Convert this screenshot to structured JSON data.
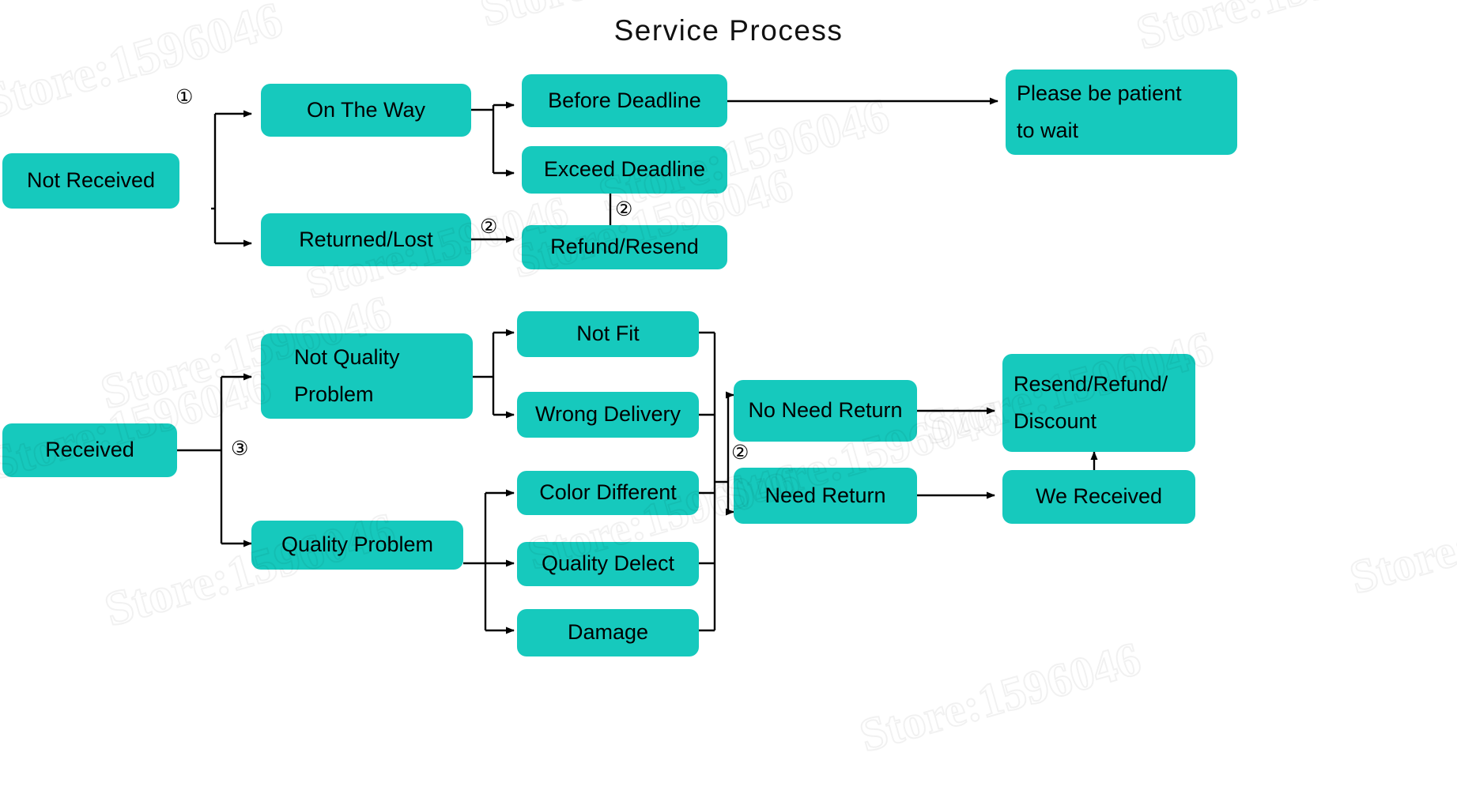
{
  "title": "Service Process",
  "colors": {
    "box_fill": "#16c9bd",
    "line": "#000000",
    "text": "#000000",
    "background": "#ffffff"
  },
  "watermark": {
    "text": "Store:1596046"
  },
  "nodes": {
    "not_received": {
      "label": "Not Received"
    },
    "on_the_way": {
      "label": "On The Way"
    },
    "returned_lost": {
      "label": "Returned/Lost"
    },
    "before_deadline": {
      "label": "Before Deadline"
    },
    "exceed_deadline": {
      "label": "Exceed Deadline"
    },
    "refund_resend": {
      "label": "Refund/Resend"
    },
    "please_wait_1": {
      "label": "Please be patient"
    },
    "please_wait_2": {
      "label": "to wait"
    },
    "received": {
      "label": "Received"
    },
    "not_quality_1": {
      "label": "Not Quality"
    },
    "not_quality_2": {
      "label": "Problem"
    },
    "quality_problem": {
      "label": "Quality Problem"
    },
    "not_fit": {
      "label": "Not Fit"
    },
    "wrong_delivery": {
      "label": "Wrong Delivery"
    },
    "color_different": {
      "label": "Color Different"
    },
    "quality_delect": {
      "label": "Quality Delect"
    },
    "damage": {
      "label": "Damage"
    },
    "no_need_return": {
      "label": "No Need Return"
    },
    "need_return": {
      "label": "Need Return"
    },
    "resend_refund_1": {
      "label": "Resend/Refund/"
    },
    "resend_refund_2": {
      "label": "Discount"
    },
    "we_received": {
      "label": "We Received"
    }
  },
  "badges": {
    "b1": "①",
    "b2_top": "②",
    "b2_exceed": "②",
    "b3": "③",
    "b2_return": "②"
  },
  "flow": {
    "edges": [
      {
        "from": "not_received",
        "to": "on_the_way",
        "marker": "①"
      },
      {
        "from": "not_received",
        "to": "returned_lost"
      },
      {
        "from": "on_the_way",
        "to": "before_deadline"
      },
      {
        "from": "on_the_way",
        "to": "exceed_deadline"
      },
      {
        "from": "before_deadline",
        "to": "please_wait"
      },
      {
        "from": "exceed_deadline",
        "to": "refund_resend",
        "marker": "②"
      },
      {
        "from": "returned_lost",
        "to": "refund_resend",
        "marker": "②"
      },
      {
        "from": "received",
        "to": "not_quality",
        "marker": "③"
      },
      {
        "from": "received",
        "to": "quality_problem"
      },
      {
        "from": "not_quality",
        "to": "not_fit"
      },
      {
        "from": "not_quality",
        "to": "wrong_delivery"
      },
      {
        "from": "quality_problem",
        "to": "color_different"
      },
      {
        "from": "quality_problem",
        "to": "quality_delect"
      },
      {
        "from": "quality_problem",
        "to": "damage"
      },
      {
        "from": "group_issues",
        "to": "no_need_return",
        "marker": "②"
      },
      {
        "from": "group_issues",
        "to": "need_return",
        "marker": "②"
      },
      {
        "from": "no_need_return",
        "to": "resend_refund"
      },
      {
        "from": "need_return",
        "to": "we_received"
      },
      {
        "from": "we_received",
        "to": "resend_refund"
      }
    ]
  }
}
